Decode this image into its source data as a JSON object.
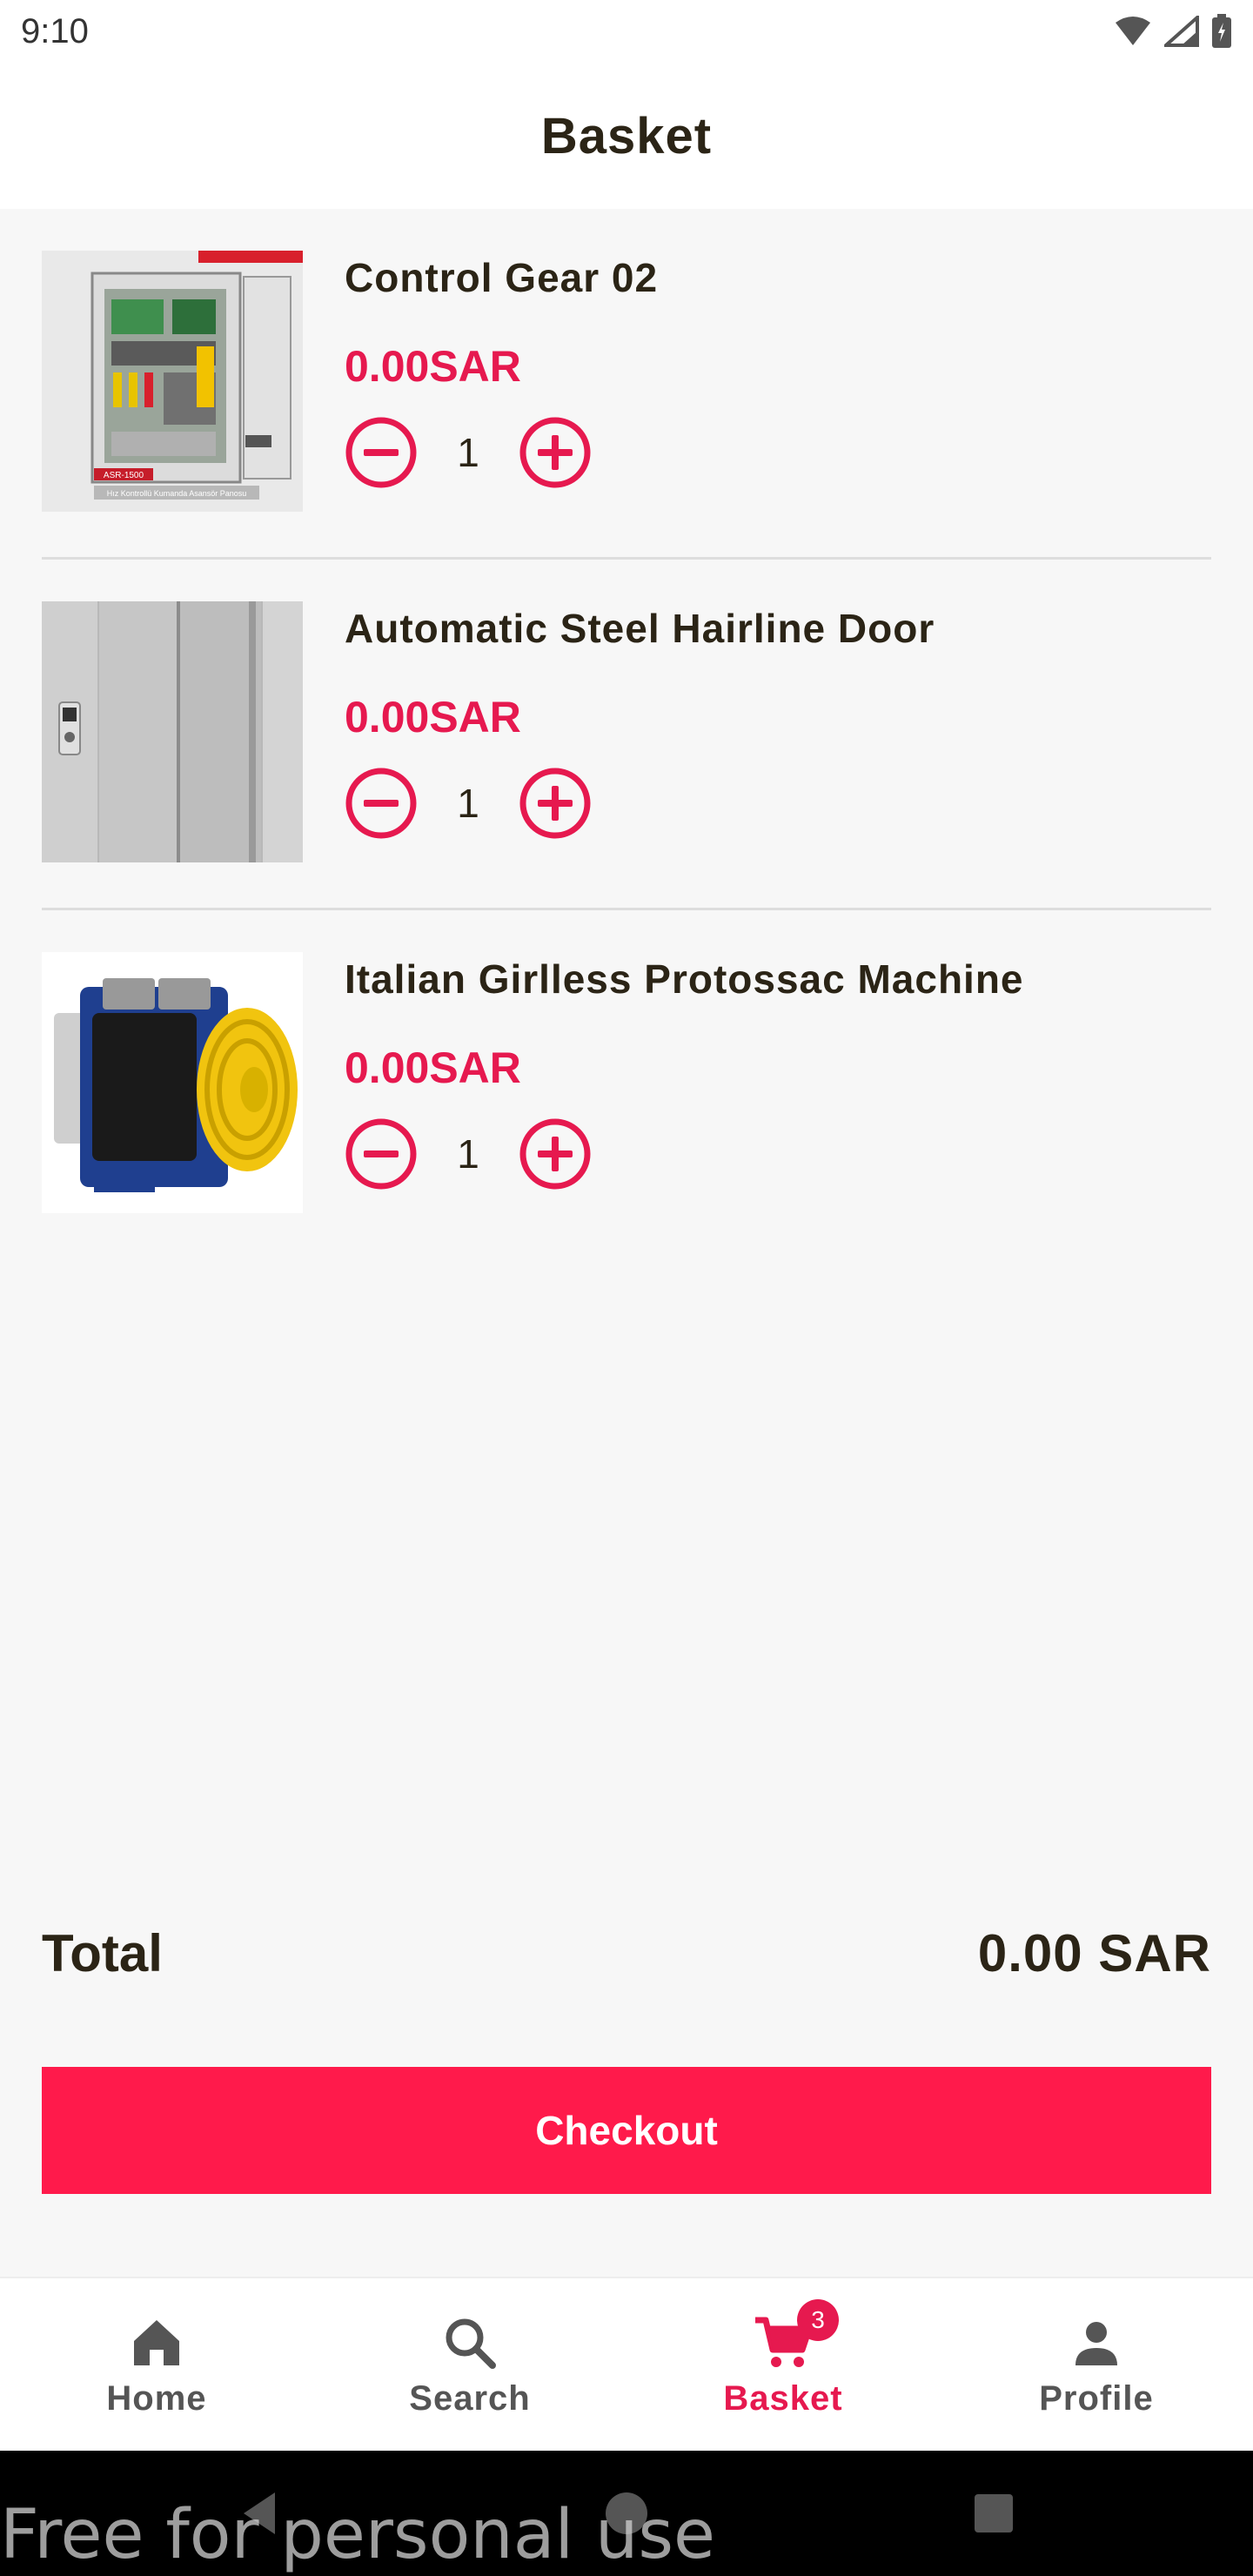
{
  "status_bar": {
    "time": "9:10"
  },
  "app_bar": {
    "title": "Basket"
  },
  "items": [
    {
      "name": "Control Gear 02",
      "price": "0.00SAR",
      "quantity": "1",
      "image_label": "ASR-1500",
      "image_caption": "Hız Kontrollü Kumanda Asansör Panosu"
    },
    {
      "name": "Automatic Steel Hairline Door",
      "price": "0.00SAR",
      "quantity": "1"
    },
    {
      "name": "Italian Girlless Protossac Machine",
      "price": "0.00SAR",
      "quantity": "1"
    }
  ],
  "total": {
    "label": "Total",
    "value": "0.00 SAR"
  },
  "checkout": {
    "label": "Checkout"
  },
  "bottom_nav": {
    "items": [
      {
        "label": "Home",
        "icon": "home-icon"
      },
      {
        "label": "Search",
        "icon": "search-icon"
      },
      {
        "label": "Basket",
        "icon": "cart-icon",
        "badge": "3",
        "active": true
      },
      {
        "label": "Profile",
        "icon": "person-icon"
      }
    ]
  },
  "watermark": {
    "text": "Free for personal use"
  },
  "colors": {
    "accent": "#e6194f",
    "button": "#ff1a4b",
    "text": "#2b2416",
    "background": "#f7f7f7"
  }
}
